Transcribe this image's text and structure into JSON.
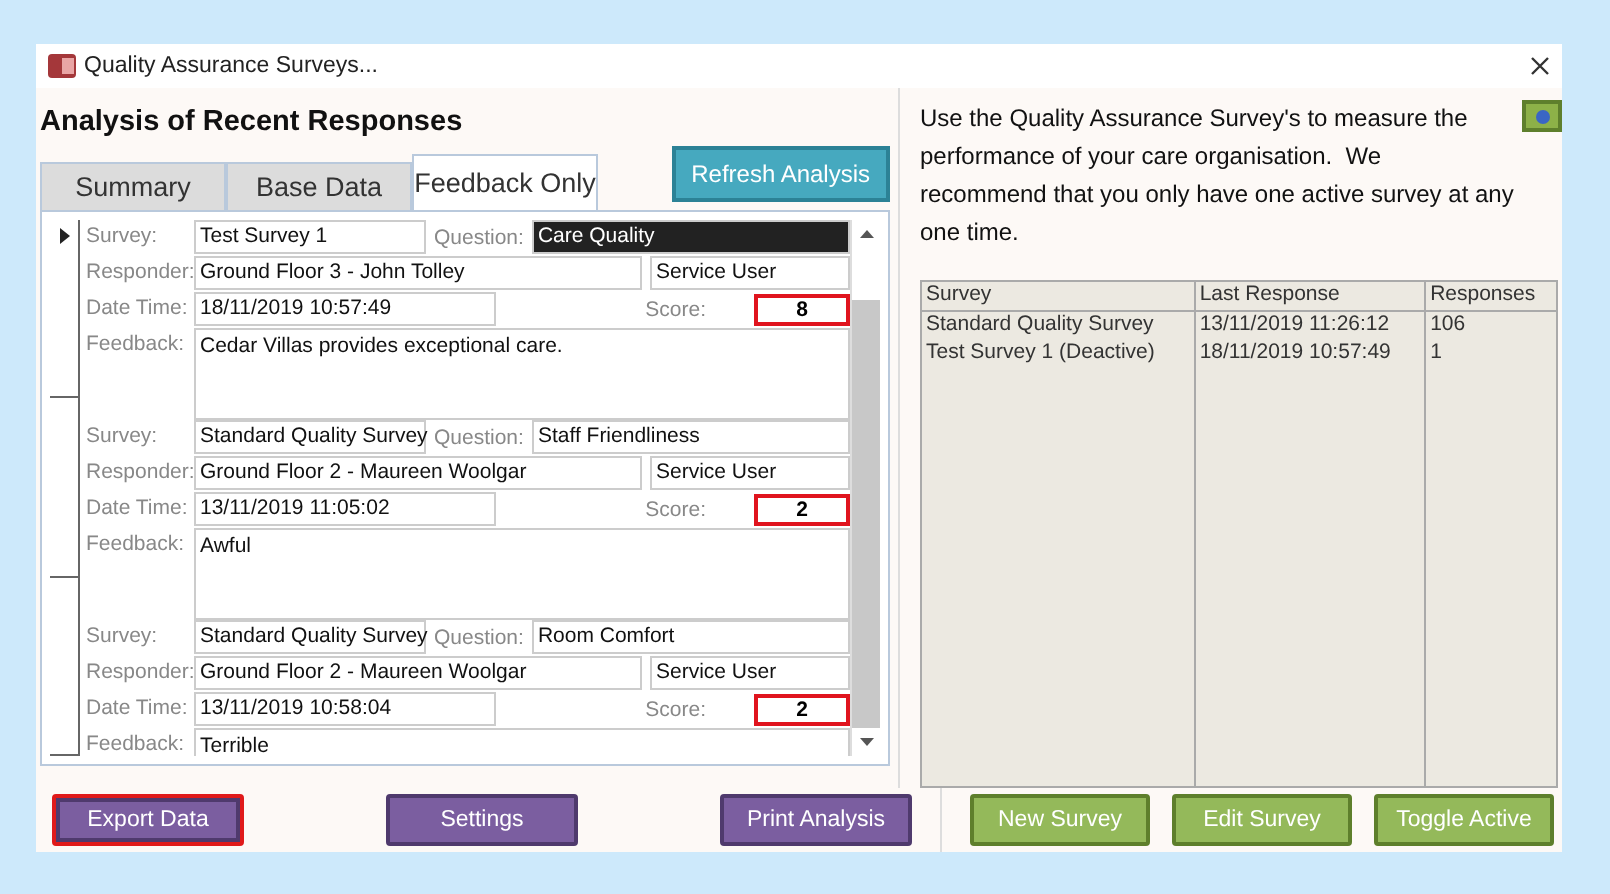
{
  "window": {
    "title": "Quality Assurance Surveys..."
  },
  "heading": "Analysis of Recent Responses",
  "tabs": [
    {
      "label": "Summary",
      "selected": false
    },
    {
      "label": "Base Data",
      "selected": false
    },
    {
      "label": "Feedback Only",
      "selected": true
    }
  ],
  "refresh_button": "Refresh Analysis",
  "records": [
    {
      "current": true,
      "labels": {
        "survey": "Survey:",
        "question": "Question:",
        "responder": "Responder:",
        "date_time": "Date Time:",
        "score": "Score:",
        "feedback": "Feedback:"
      },
      "survey": "Test Survey 1",
      "question": "Care Quality",
      "question_selected": true,
      "responder": "Ground Floor 3 - John Tolley",
      "responder_type": "Service User",
      "date_time": "18/11/2019 10:57:49",
      "score": "8",
      "feedback": "Cedar Villas provides exceptional care."
    },
    {
      "current": false,
      "labels": {
        "survey": "Survey:",
        "question": "Question:",
        "responder": "Responder:",
        "date_time": "Date Time:",
        "score": "Score:",
        "feedback": "Feedback:"
      },
      "survey": "Standard Quality Survey",
      "question": "Staff Friendliness",
      "question_selected": false,
      "responder": "Ground Floor 2 - Maureen Woolgar",
      "responder_type": "Service User",
      "date_time": "13/11/2019 11:05:02",
      "score": "2",
      "feedback": "Awful"
    },
    {
      "current": false,
      "labels": {
        "survey": "Survey:",
        "question": "Question:",
        "responder": "Responder:",
        "date_time": "Date Time:",
        "score": "Score:",
        "feedback": "Feedback:"
      },
      "survey": "Standard Quality Survey",
      "question": "Room Comfort",
      "question_selected": false,
      "responder": "Ground Floor 2 - Maureen Woolgar",
      "responder_type": "Service User",
      "date_time": "13/11/2019 10:58:04",
      "score": "2",
      "feedback": "Terrible"
    }
  ],
  "intro": "Use the Quality Assurance Survey's to measure the performance of your care organisation.  We recommend that you only have one active survey at any one time.",
  "table": {
    "columns": [
      "Survey",
      "Last Response",
      "Responses"
    ],
    "rows": [
      [
        "Standard Quality Survey",
        "13/11/2019 11:26:12",
        "106"
      ],
      [
        "Test Survey 1 (Deactive)",
        "18/11/2019 10:57:49",
        "1"
      ]
    ]
  },
  "left_buttons": [
    {
      "label": "Export Data",
      "highlighted": true
    },
    {
      "label": "Settings",
      "highlighted": false
    },
    {
      "label": "Print Analysis",
      "highlighted": false
    }
  ],
  "right_buttons": [
    {
      "label": "New Survey",
      "highlighted": false
    },
    {
      "label": "Edit Survey",
      "highlighted": false
    },
    {
      "label": "Toggle Active",
      "highlighted": false
    }
  ]
}
